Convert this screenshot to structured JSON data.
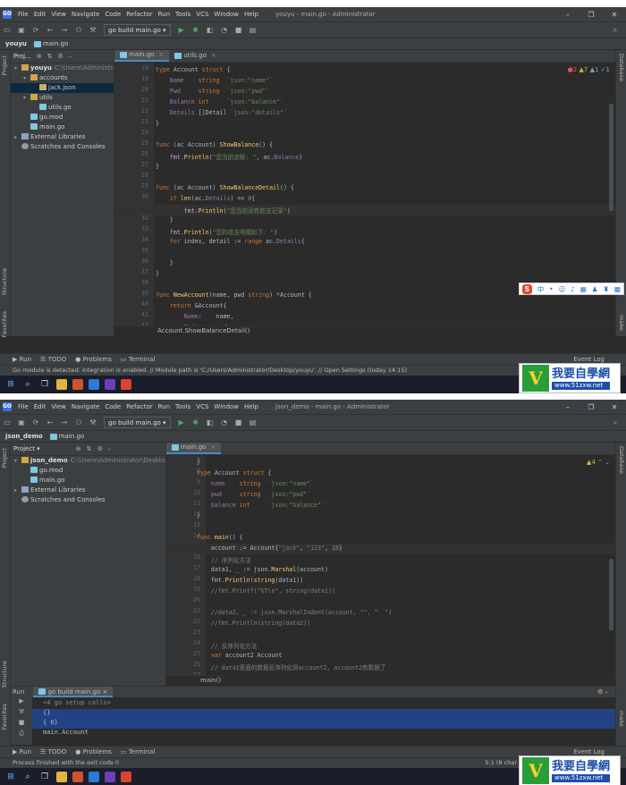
{
  "menu": [
    "File",
    "Edit",
    "View",
    "Navigate",
    "Code",
    "Refactor",
    "Run",
    "Tools",
    "VCS",
    "Window",
    "Help"
  ],
  "window_controls": {
    "minimize": "–",
    "restore": "❐",
    "close": "✕"
  },
  "toolbar": {
    "run_config": "go build main.go ▾"
  },
  "side_labels": {
    "project": "Project",
    "structure": "Structure",
    "favorites": "Favorites",
    "database": "Database",
    "make": "make"
  },
  "tool_windows": {
    "run": "Run",
    "todo": "TODO",
    "problems": "Problems",
    "terminal": "Terminal",
    "event_log": "Event Log"
  },
  "ime_text": "中",
  "watermark": {
    "letter": "V",
    "cn": "我要自學網",
    "url": "www.51zxw.net"
  },
  "win1": {
    "title": "youyu - main.go - Administrator",
    "project_name": "youyu",
    "crumb_file": "main.go",
    "panel_title": "Proj...",
    "tabs": [
      {
        "label": "main.go",
        "active": true
      },
      {
        "label": "utils.go",
        "active": false
      }
    ],
    "inspections": {
      "errors": "2",
      "warnings": "7",
      "info": "1",
      "typos": "1"
    },
    "tree": [
      {
        "label": "youyu",
        "path": "C:\\Users\\Administrat",
        "indent": 0,
        "arrow": "▾",
        "icon": "folder"
      },
      {
        "label": "accounts",
        "path": "",
        "indent": 1,
        "arrow": "▾",
        "icon": "folder"
      },
      {
        "label": "jack.json",
        "path": "",
        "indent": 2,
        "arrow": "",
        "icon": "json",
        "selected": true
      },
      {
        "label": "utils",
        "path": "",
        "indent": 1,
        "arrow": "▾",
        "icon": "folder"
      },
      {
        "label": "utils.go",
        "path": "",
        "indent": 2,
        "arrow": "",
        "icon": "go"
      },
      {
        "label": "go.mod",
        "path": "",
        "indent": 1,
        "arrow": "",
        "icon": "go"
      },
      {
        "label": "main.go",
        "path": "",
        "indent": 1,
        "arrow": "",
        "icon": "go"
      },
      {
        "label": "External Libraries",
        "path": "",
        "indent": 0,
        "arrow": "▸",
        "icon": "lib"
      },
      {
        "label": "Scratches and Consoles",
        "path": "",
        "indent": 0,
        "arrow": "",
        "icon": "scratch"
      }
    ],
    "gutter_numbers": [
      "18",
      "19",
      "20",
      "21",
      "22",
      "23",
      "24",
      "25",
      "26",
      "27",
      "28",
      "29",
      "30",
      "31",
      "32",
      "33",
      "34",
      "35",
      "36",
      "37",
      "38",
      "39",
      "40",
      "41",
      "42",
      "43"
    ],
    "current_line_index": 13,
    "breadcrumb": "Account.ShowBalanceDetail()",
    "status": "Go module is detected: Integration is enabled. // Module path is 'C:/Users/Administrator/Desktop/youyu'. // Open Settings (today 14:15)"
  },
  "win2": {
    "title": "json_demo - main.go - Administrator",
    "project_name": "json_demo",
    "crumb_file": "main.go",
    "panel_title": "Project ▾",
    "tabs": [
      {
        "label": "main.go",
        "active": true
      }
    ],
    "inspections": {
      "warnings": "4"
    },
    "tree": [
      {
        "label": "json_demo",
        "path": "C:\\Users\\Administrator\\Desktop\\d",
        "indent": 0,
        "arrow": "▾",
        "icon": "folder"
      },
      {
        "label": "go.mod",
        "path": "",
        "indent": 1,
        "arrow": "",
        "icon": "go"
      },
      {
        "label": "main.go",
        "path": "",
        "indent": 1,
        "arrow": "",
        "icon": "go"
      },
      {
        "label": "External Libraries",
        "path": "",
        "indent": 0,
        "arrow": "▸",
        "icon": "lib"
      },
      {
        "label": "Scratches and Consoles",
        "path": "",
        "indent": 0,
        "arrow": "",
        "icon": "scratch"
      }
    ],
    "gutter_numbers": [
      "7",
      "8",
      "9",
      "10",
      "11",
      "12",
      "13",
      "14",
      "15",
      "16",
      "17",
      "18",
      "19",
      "20",
      "21",
      "22",
      "23",
      "24",
      "25",
      "26",
      "27",
      "28"
    ],
    "current_line_index": 8,
    "breadcrumb": "main()",
    "run_tab": "go build main.go",
    "run_output": [
      "<4 go setup calls>",
      "{}",
      "{ 0}",
      "main.Account"
    ],
    "run_selected": [
      1,
      2
    ],
    "status": "Process finished with the exit code 0",
    "status_right": "5:1 (8 char"
  }
}
